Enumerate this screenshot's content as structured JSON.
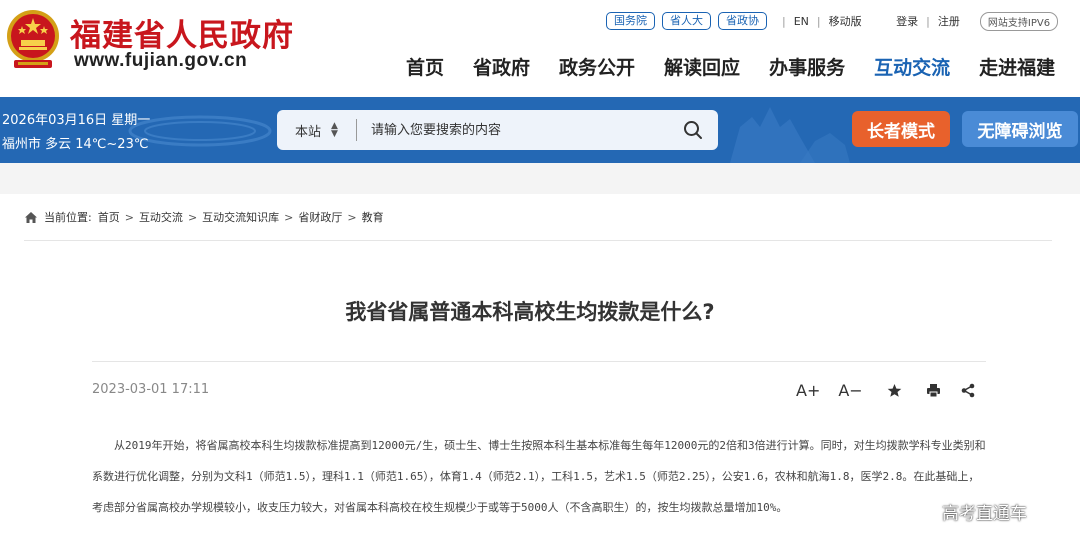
{
  "header": {
    "site_title": "福建省人民政府",
    "site_url": "www.fujian.gov.cn",
    "top_pills": [
      "国务院",
      "省人大",
      "省政协"
    ],
    "lang_en": "EN",
    "mobile": "移动版",
    "login": "登录",
    "register": "注册",
    "ipv6": "网站支持IPV6"
  },
  "nav": {
    "items": [
      "首页",
      "省政府",
      "政务公开",
      "解读回应",
      "办事服务",
      "互动交流",
      "走进福建"
    ],
    "active": "互动交流"
  },
  "banner": {
    "date": "2026年03月16日 星期一",
    "weather": "福州市 多云 14℃~23℃",
    "search_scope": "本站",
    "search_placeholder": "请输入您要搜索的内容",
    "elder_mode": "长者模式",
    "accessibility": "无障碍浏览"
  },
  "breadcrumb": {
    "label": "当前位置:",
    "items": [
      "首页",
      "互动交流",
      "互动交流知识库",
      "省财政厅",
      "教育"
    ]
  },
  "article": {
    "title": "我省省属普通本科高校生均拨款是什么?",
    "published": "2023-03-01 17:11",
    "tools": {
      "font_up": "A+",
      "font_down": "A−"
    },
    "body": "从2019年开始，将省属高校本科生均拨款标准提高到12000元/生，硕士生、博士生按照本科生基本标准每生每年12000元的2倍和3倍进行计算。同时，对生均拨款学科专业类别和系数进行优化调整，分别为文科1（师范1.5），理科1.1（师范1.65），体育1.4（师范2.1），工科1.5，艺术1.5（师范2.25），公安1.6，农林和航海1.8，医学2.8。在此基础上，考虑部分省属高校办学规模较小，收支压力较大，对省属本科高校在校生规模少于或等于5000人（不含高职生）的，按生均拨款总量增加10%。"
  },
  "watermark": "高考直通车",
  "colors": {
    "brand_red": "#c8161d",
    "brand_blue": "#1a63b3",
    "banner_blue": "#2468b4",
    "elder_orange": "#e8612c",
    "access_blue": "#4a8bd6"
  },
  "icons": [
    "national-emblem-icon",
    "search-icon",
    "home-icon",
    "star-icon",
    "print-icon",
    "share-icon",
    "sort-arrows-icon"
  ]
}
